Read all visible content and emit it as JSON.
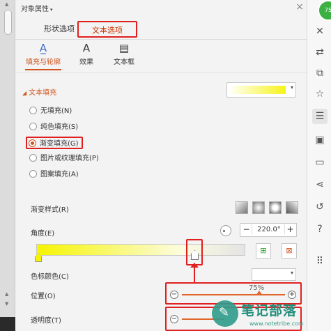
{
  "panel": {
    "title": "对象属性",
    "title_caret": "▾",
    "close": "×"
  },
  "tabs": {
    "shape_options": "形状选项",
    "text_options": "文本选项"
  },
  "subtabs": {
    "fill_outline": "填充与轮廓",
    "effects": "效果",
    "textbox": "文本框"
  },
  "text_fill": {
    "header": "文本填充",
    "options": [
      "无填充(N)",
      "纯色填充(S)",
      "渐变填充(G)",
      "图片或纹理填充(P)",
      "图案填充(A)"
    ],
    "selected": "渐变填充(G)"
  },
  "gradient": {
    "style_label": "渐变样式(R)",
    "angle_label": "角度(E)",
    "angle_value": "220.0°",
    "angle_minus": "−",
    "angle_plus": "+",
    "stop_color_label": "色标颜色(C)",
    "position_label": "位置(O)",
    "position_value": "75%",
    "position_fraction": 0.75,
    "transparency_label": "透明度(T)"
  },
  "watermark": {
    "title": "笔记部落",
    "url": "www.notetribe.com"
  },
  "avatar": {
    "text": "75"
  },
  "colors": {
    "accent": "#d2531c",
    "highlight_box": "#e02020",
    "gradient_start": "#f6f400",
    "gradient_end": "#e4e4e4",
    "watermark": "#1f8f7a"
  },
  "right_toolbar_icons": [
    "close-icon",
    "arrow-icon",
    "shape-icon",
    "star-icon",
    "property-icon",
    "image-icon",
    "archive-icon",
    "share-icon",
    "history-icon",
    "help-icon",
    "grid-icon"
  ]
}
